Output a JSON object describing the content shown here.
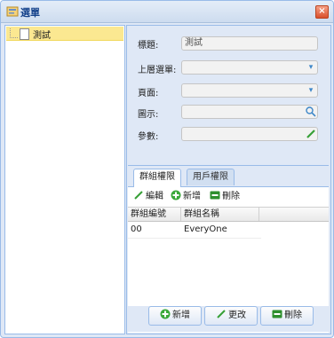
{
  "window": {
    "title": "選單"
  },
  "tree": {
    "items": [
      {
        "label": "測試"
      }
    ]
  },
  "form": {
    "title_label": "標題:",
    "title_value": "測試",
    "parent_label": "上層選單:",
    "page_label": "頁面:",
    "icon_label": "圖示:",
    "param_label": "參數:"
  },
  "tabs": {
    "active": "群組權限",
    "inactive": "用戶權限"
  },
  "toolbar": {
    "edit": "編輯",
    "add": "新增",
    "delete": "刪除"
  },
  "grid": {
    "headers": [
      "群組編號",
      "群組名稱"
    ],
    "rows": [
      {
        "id": "00",
        "name": "EveryOne"
      }
    ]
  },
  "footer": {
    "add": "新增",
    "update": "更改",
    "delete": "刪除"
  },
  "colors": {
    "accent": "#99bbe8",
    "panel_bg": "#dfe8f6",
    "selected": "#fbe891"
  }
}
